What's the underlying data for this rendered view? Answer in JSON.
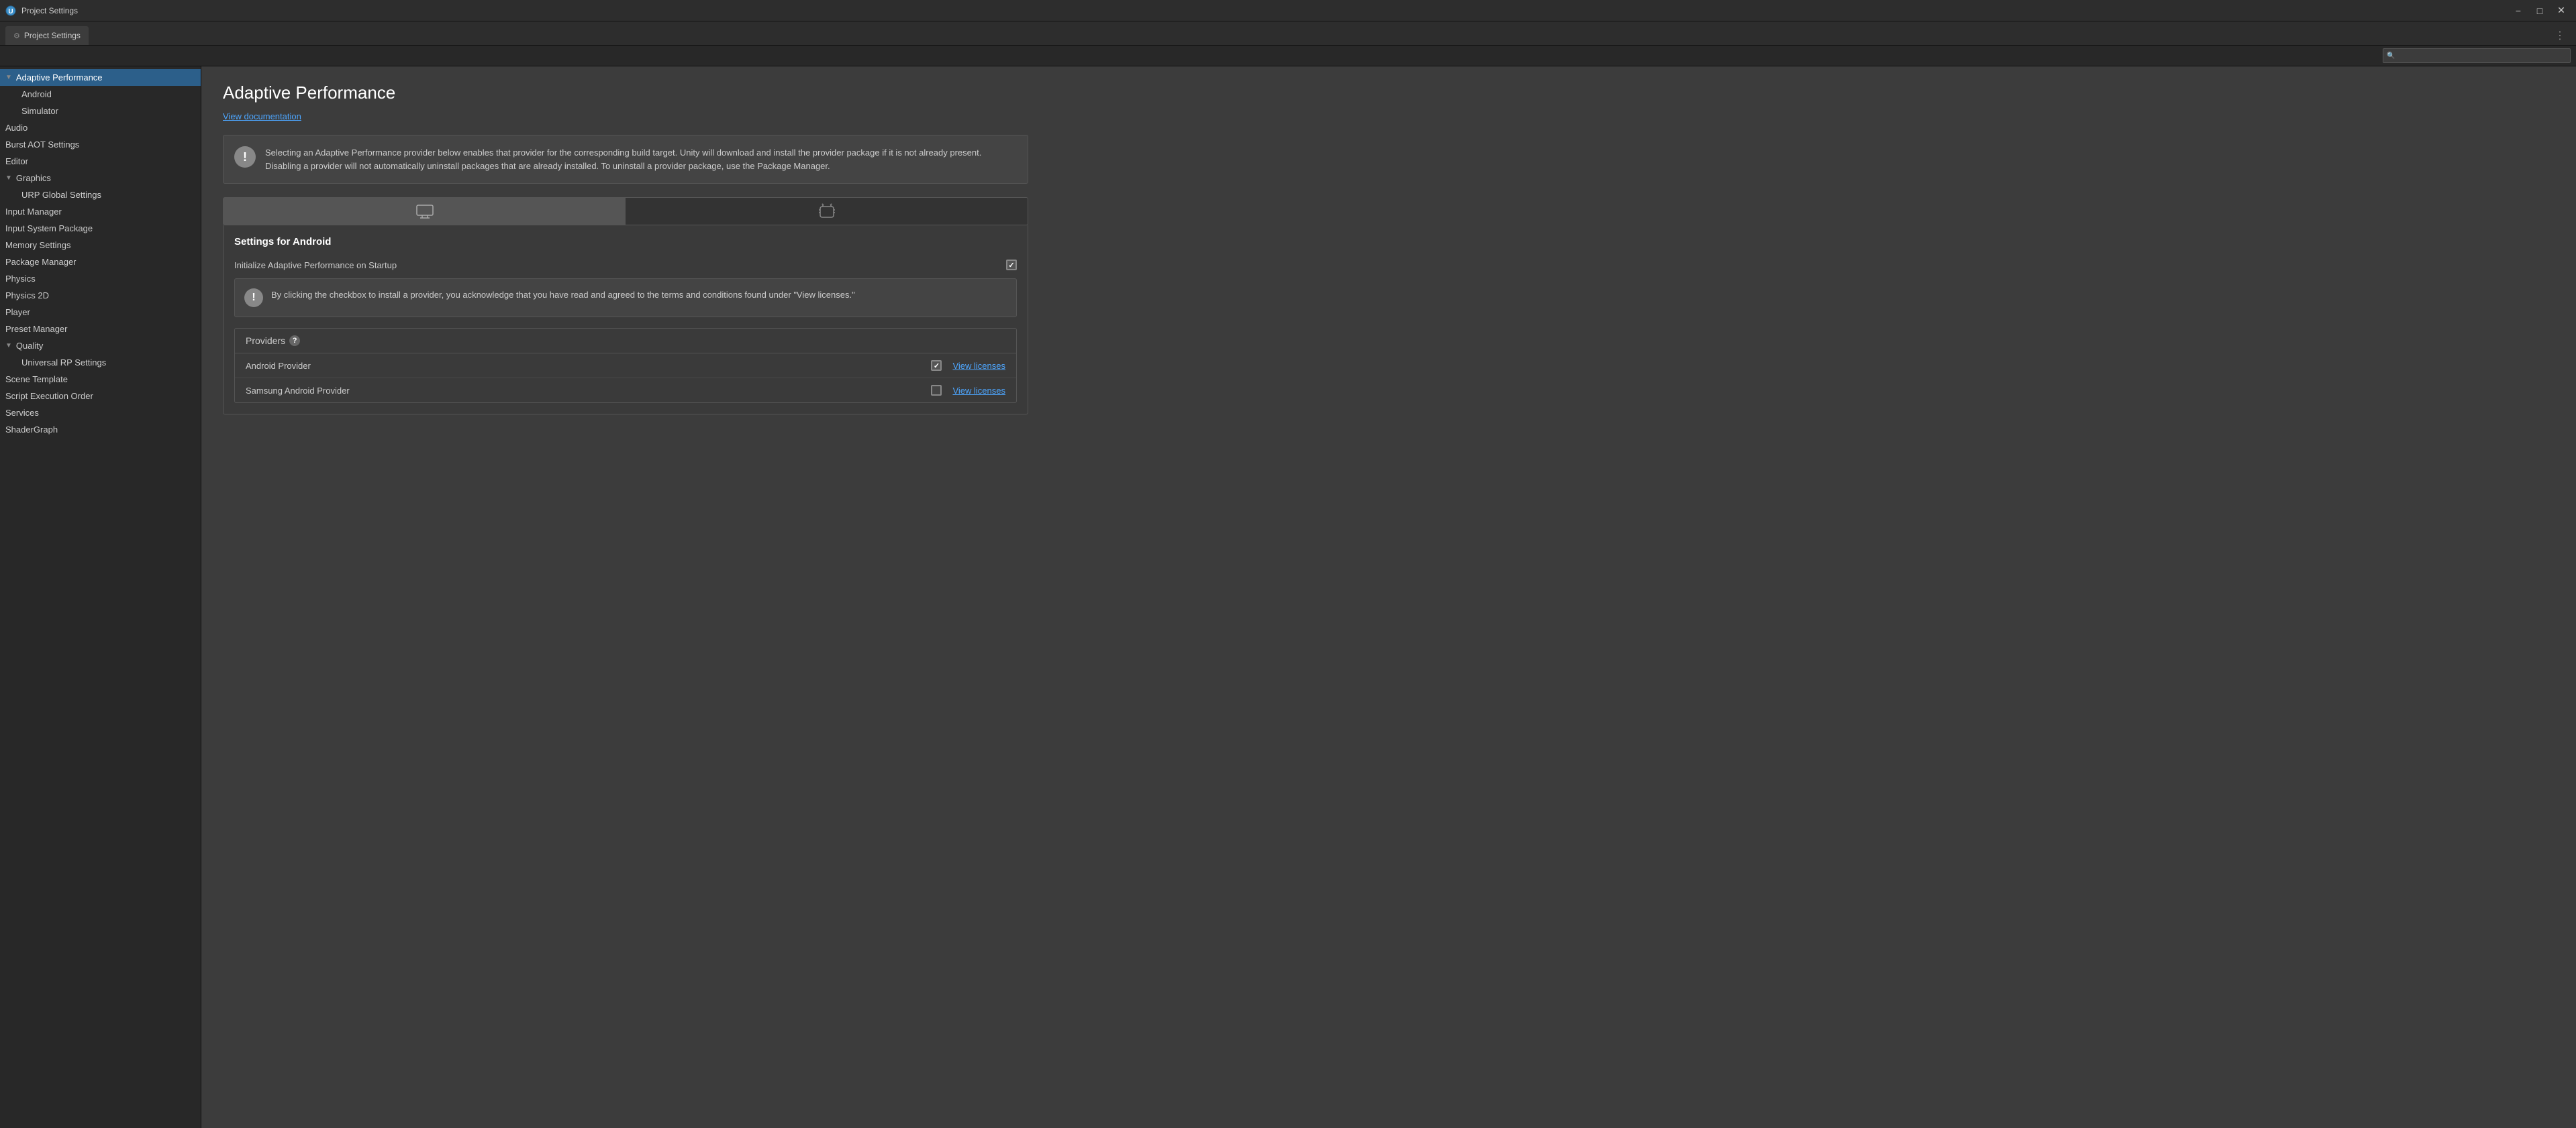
{
  "window": {
    "title": "Project Settings",
    "tab_label": "Project Settings",
    "minimize_label": "−",
    "maximize_label": "□",
    "close_label": "✕"
  },
  "header": {
    "menu_dots": "⋮",
    "search_placeholder": ""
  },
  "sidebar": {
    "items": [
      {
        "id": "adaptive-performance",
        "label": "Adaptive Performance",
        "type": "parent",
        "expanded": true,
        "selected": true,
        "triangle": "down"
      },
      {
        "id": "android",
        "label": "Android",
        "type": "child",
        "selected": false
      },
      {
        "id": "simulator",
        "label": "Simulator",
        "type": "child",
        "selected": false
      },
      {
        "id": "audio",
        "label": "Audio",
        "type": "item",
        "selected": false
      },
      {
        "id": "burst-aot",
        "label": "Burst AOT Settings",
        "type": "item",
        "selected": false
      },
      {
        "id": "editor",
        "label": "Editor",
        "type": "item",
        "selected": false
      },
      {
        "id": "graphics",
        "label": "Graphics",
        "type": "parent",
        "expanded": true,
        "selected": false,
        "triangle": "down"
      },
      {
        "id": "urp-global",
        "label": "URP Global Settings",
        "type": "child",
        "selected": false
      },
      {
        "id": "input-manager",
        "label": "Input Manager",
        "type": "item",
        "selected": false
      },
      {
        "id": "input-system",
        "label": "Input System Package",
        "type": "item",
        "selected": false
      },
      {
        "id": "memory-settings",
        "label": "Memory Settings",
        "type": "item",
        "selected": false
      },
      {
        "id": "package-manager",
        "label": "Package Manager",
        "type": "item",
        "selected": false
      },
      {
        "id": "physics",
        "label": "Physics",
        "type": "item",
        "selected": false
      },
      {
        "id": "physics-2d",
        "label": "Physics 2D",
        "type": "item",
        "selected": false
      },
      {
        "id": "player",
        "label": "Player",
        "type": "item",
        "selected": false
      },
      {
        "id": "preset-manager",
        "label": "Preset Manager",
        "type": "item",
        "selected": false
      },
      {
        "id": "quality",
        "label": "Quality",
        "type": "parent",
        "expanded": true,
        "selected": false,
        "triangle": "down"
      },
      {
        "id": "universal-rp",
        "label": "Universal RP Settings",
        "type": "child",
        "selected": false
      },
      {
        "id": "scene-template",
        "label": "Scene Template",
        "type": "item",
        "selected": false
      },
      {
        "id": "script-execution",
        "label": "Script Execution Order",
        "type": "item",
        "selected": false
      },
      {
        "id": "services",
        "label": "Services",
        "type": "item",
        "selected": false
      },
      {
        "id": "shader-graph",
        "label": "ShaderGraph",
        "type": "item",
        "selected": false
      }
    ]
  },
  "content": {
    "page_title": "Adaptive Performance",
    "view_documentation_label": "View documentation",
    "info_box": {
      "icon": "!",
      "text": "Selecting an Adaptive Performance provider below enables that provider for the corresponding build target. Unity will download and install the provider package if it is not already present. Disabling a provider will not automatically uninstall packages that are already installed. To uninstall a provider package, use the Package Manager."
    },
    "platform_tabs": [
      {
        "id": "desktop",
        "icon": "🖥",
        "active": true
      },
      {
        "id": "android",
        "icon": "📱",
        "active": false
      }
    ],
    "android_tab_icon": "🤖",
    "settings_for_android_label": "Settings for Android",
    "initialize_label": "Initialize Adaptive Performance on Startup",
    "initialize_checked": true,
    "warning_box": {
      "icon": "!",
      "text": "By clicking the checkbox to install a provider, you acknowledge that you have read and agreed to the terms and conditions found under \"View licenses.\""
    },
    "providers_label": "Providers",
    "providers": [
      {
        "id": "android-provider",
        "name": "Android Provider",
        "checked": true,
        "view_licenses": "View licenses"
      },
      {
        "id": "samsung-provider",
        "name": "Samsung Android Provider",
        "checked": false,
        "view_licenses": "View licenses"
      }
    ]
  }
}
